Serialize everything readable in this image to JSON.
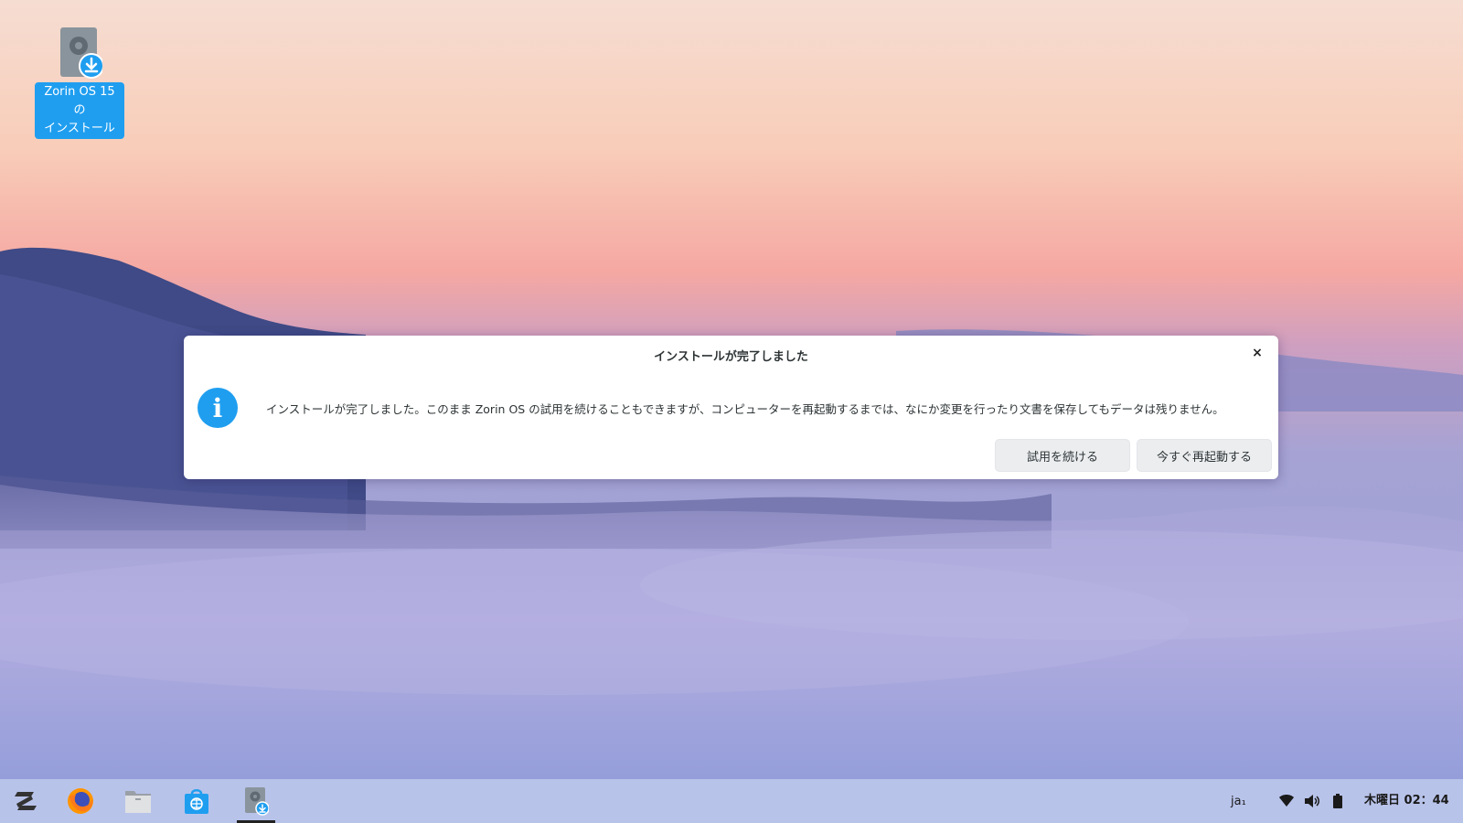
{
  "desktop": {
    "installer_icon": {
      "label_line1": "Zorin OS 15 の",
      "label_line2": "インストール"
    }
  },
  "dialog": {
    "title": "インストールが完了しました",
    "close_glyph": "×",
    "info_glyph": "i",
    "message": "インストールが完了しました。このまま Zorin OS の試用を続けることもできますが、コンピューターを再起動するまでは、なにか変更を行ったり文書を保存してもデータは残りません。",
    "buttons": {
      "continue": "試用を続ける",
      "restart": "今すぐ再起動する"
    }
  },
  "taskbar": {
    "items": [
      "zorin-menu-icon",
      "firefox-icon",
      "files-icon",
      "software-store-icon",
      "installer-icon"
    ],
    "active_item": "installer-icon",
    "tray": {
      "language": "ja₁",
      "icons": [
        "wifi-icon",
        "volume-icon",
        "battery-icon"
      ]
    },
    "clock": "木曜日 02：44"
  },
  "colors": {
    "accent": "#1f9ef0",
    "taskbar": "#b8c3ea",
    "dialog_bg": "#ffffff",
    "button_bg": "#ebedef"
  }
}
